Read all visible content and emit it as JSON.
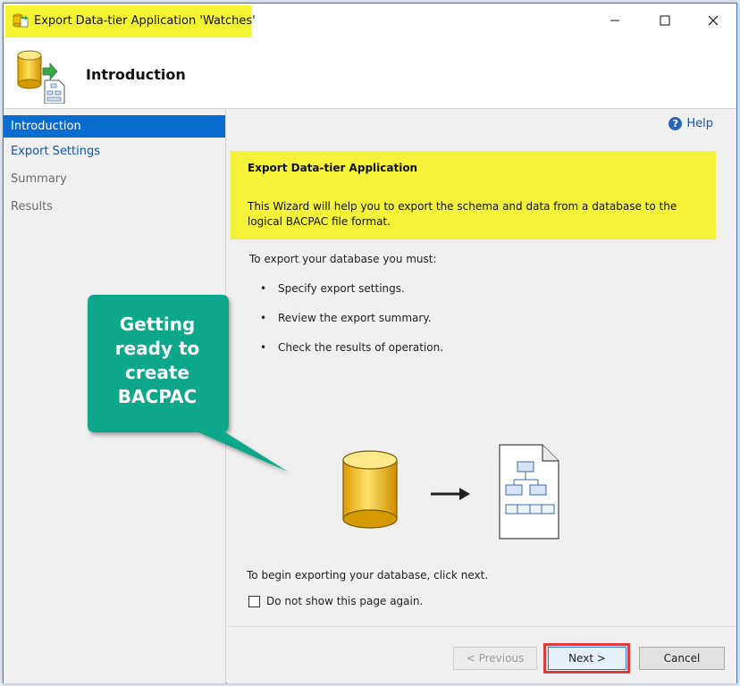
{
  "window": {
    "title": "Export Data-tier Application 'Watches'",
    "minimize_icon": "minimize-icon",
    "maximize_icon": "maximize-icon",
    "close_icon": "close-icon"
  },
  "header": {
    "title": "Introduction",
    "icon": "database-export-icon"
  },
  "sidebar": {
    "items": [
      {
        "label": "Introduction",
        "state": "active"
      },
      {
        "label": "Export Settings",
        "state": "link"
      },
      {
        "label": "Summary",
        "state": "disabled"
      },
      {
        "label": "Results",
        "state": "disabled"
      }
    ]
  },
  "main": {
    "help_label": "Help",
    "intro_heading": "Export Data-tier Application",
    "intro_text": "This Wizard will help you to export the schema and data from a database to the logical BACPAC file format.",
    "must_text": "To export your database you must:",
    "steps": [
      "Specify export settings.",
      "Review the export summary.",
      "Check the results of operation."
    ],
    "begin_text": "To begin exporting your database, click next.",
    "checkbox_label": "Do not show this page again.",
    "checkbox_checked": false
  },
  "footer": {
    "previous_label": "< Previous",
    "next_label": "Next >",
    "cancel_label": "Cancel"
  },
  "callout": {
    "text": "Getting ready to create BACPAC",
    "color": "#10a88a"
  },
  "colors": {
    "highlight_yellow": "#f4f432",
    "nav_active": "#0a6cce",
    "link_blue": "#1555a8",
    "next_outline": "#e03a3a"
  }
}
